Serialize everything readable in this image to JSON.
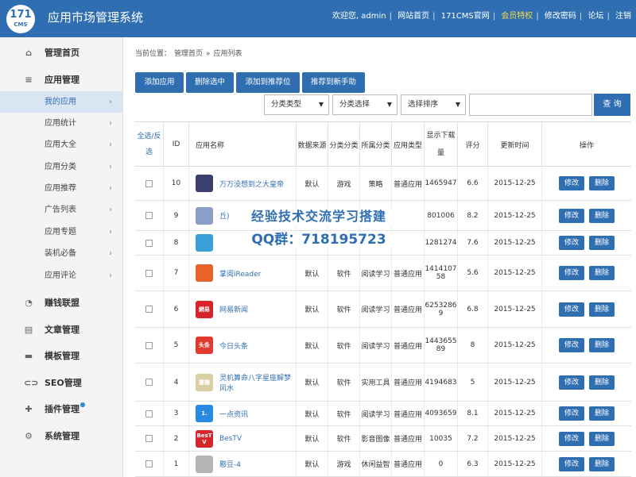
{
  "header": {
    "logo_number": "171",
    "logo_text": "CMS",
    "title": "应用市场管理系统",
    "welcome": "欢迎您, admin",
    "links": [
      "网站首页",
      "171CMS官网",
      "会员特权",
      "修改密码",
      "论坛",
      "注销"
    ]
  },
  "sidebar": {
    "sections": [
      {
        "label": "管理首页",
        "icon": "home-icon"
      },
      {
        "label": "应用管理",
        "icon": "menu-icon"
      }
    ],
    "sub_items": [
      "我的应用",
      "应用统计",
      "应用大全",
      "应用分类",
      "应用推荐",
      "广告列表",
      "应用专题",
      "装机必备",
      "应用评论"
    ],
    "bottom_sections": [
      {
        "label": "赚钱联盟",
        "icon": "pie-chart-icon"
      },
      {
        "label": "文章管理",
        "icon": "document-icon"
      },
      {
        "label": "模板管理",
        "icon": "folder-icon"
      },
      {
        "label": "SEO管理",
        "icon": "link-icon"
      },
      {
        "label": "插件管理",
        "icon": "puzzle-icon"
      },
      {
        "label": "系统管理",
        "icon": "gear-icon"
      }
    ]
  },
  "breadcrumb": {
    "prefix": "当前位置：",
    "home": "管理首页",
    "sep": "»",
    "current": "应用列表"
  },
  "toolbar": {
    "add": "添加应用",
    "delete": "删除选中",
    "recommend": "添加到推荐位",
    "new_hand": "推荐到新手助"
  },
  "filters": {
    "type": "分类类型",
    "category": "分类选择",
    "sort": "选择排序",
    "search": "查 询"
  },
  "table": {
    "headers": {
      "select_all": "全选/反选",
      "id": "ID",
      "name": "应用名称",
      "source": "数据来源",
      "cat_class": "分类分类",
      "cat": "所属分类",
      "app_type": "应用类型",
      "downloads": "显示下载量",
      "score": "评分",
      "updated": "更新时间",
      "ops": "操作"
    },
    "edit": "修改",
    "del": "删除",
    "rows": [
      {
        "id": "10",
        "name": "万万没想到之大皇帝",
        "source": "默认",
        "cat_class": "游戏",
        "cat": "策略",
        "type": "普通应用",
        "downloads": "1465947",
        "score": "6.6",
        "date": "2015-12-25",
        "icon_color": "#3b3f6e",
        "icon_text": ""
      },
      {
        "id": "9",
        "name": "丘)",
        "source": "默认",
        "cat_class": "",
        "cat": "",
        "type": "",
        "downloads": "801006",
        "score": "8.2",
        "date": "2015-12-25",
        "icon_color": "#8aa0c8",
        "icon_text": ""
      },
      {
        "id": "8",
        "name": "",
        "source": "",
        "cat_class": "",
        "cat": "",
        "type": "",
        "downloads": "1281274",
        "score": "7.6",
        "date": "2015-12-25",
        "icon_color": "#3aa0d8",
        "icon_text": ""
      },
      {
        "id": "7",
        "name": "掌阅iReader",
        "source": "默认",
        "cat_class": "软件",
        "cat": "阅读学习",
        "type": "普通应用",
        "downloads": "1414107 58",
        "score": "5.6",
        "date": "2015-12-25",
        "icon_color": "#e8622a",
        "icon_text": ""
      },
      {
        "id": "6",
        "name": "网易新闻",
        "source": "默认",
        "cat_class": "软件",
        "cat": "阅读学习",
        "type": "普通应用",
        "downloads": "6253286 9",
        "score": "6.8",
        "date": "2015-12-25",
        "icon_color": "#d8232a",
        "icon_text": "網易"
      },
      {
        "id": "5",
        "name": "今日头条",
        "source": "默认",
        "cat_class": "软件",
        "cat": "阅读学习",
        "type": "普通应用",
        "downloads": "1443655 89",
        "score": "8",
        "date": "2015-12-25",
        "icon_color": "#e23a2e",
        "icon_text": "头条"
      },
      {
        "id": "4",
        "name": "灵机算命八字星座解梦风水",
        "source": "默认",
        "cat_class": "软件",
        "cat": "实用工具",
        "type": "普通应用",
        "downloads": "4194683",
        "score": "5",
        "date": "2015-12-25",
        "icon_color": "#d9cfa3",
        "icon_text": "靈機"
      },
      {
        "id": "3",
        "name": "一点资讯",
        "source": "默认",
        "cat_class": "软件",
        "cat": "阅读学习",
        "type": "普通应用",
        "downloads": "4093659",
        "score": "8.1",
        "date": "2015-12-25",
        "icon_color": "#2a8ae0",
        "icon_text": "1."
      },
      {
        "id": "2",
        "name": "BesTV",
        "source": "默认",
        "cat_class": "软件",
        "cat": "影音图像",
        "type": "普通应用",
        "downloads": "10035",
        "score": "7.2",
        "date": "2015-12-25",
        "icon_color": "#d6262c",
        "icon_text": "BesTV"
      },
      {
        "id": "1",
        "name": "憨豆-4",
        "source": "默认",
        "cat_class": "游戏",
        "cat": "休闲益智",
        "type": "普通应用",
        "downloads": "0",
        "score": "6.3",
        "date": "2015-12-25",
        "icon_color": "#b5b5b5",
        "icon_text": ""
      }
    ]
  },
  "watermark": {
    "line1": "经验技术交流学习搭建",
    "line2": "QQ群：718195723"
  }
}
